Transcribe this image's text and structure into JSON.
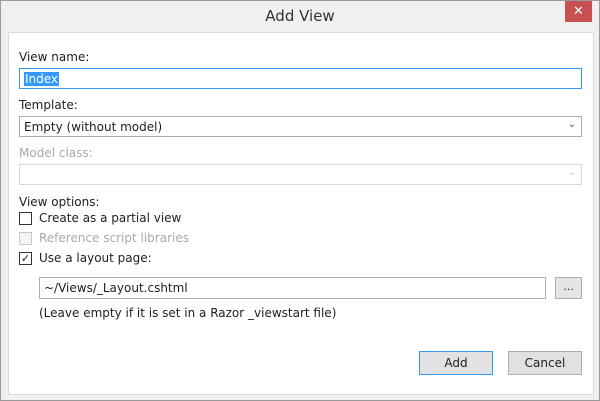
{
  "window": {
    "title": "Add View",
    "close_glyph": "✕"
  },
  "form": {
    "view_name": {
      "label": "View name:",
      "value": "Index"
    },
    "template": {
      "label": "Template:",
      "value": "Empty (without model)"
    },
    "model_class": {
      "label": "Model class:",
      "value": ""
    },
    "view_options": {
      "label": "View options:",
      "partial_view": {
        "label": "Create as a partial view",
        "checked": false
      },
      "script_libraries": {
        "label": "Reference script libraries",
        "checked": false,
        "disabled": true
      },
      "layout_page": {
        "label": "Use a layout page:",
        "checked": true,
        "check_glyph": "✓"
      }
    },
    "layout_path": {
      "value": "~/Views/_Layout.cshtml"
    },
    "browse_label": "...",
    "hint": "(Leave empty if it is set in a Razor _viewstart file)"
  },
  "buttons": {
    "add": "Add",
    "cancel": "Cancel"
  },
  "icons": {
    "chevron": "⌄"
  }
}
